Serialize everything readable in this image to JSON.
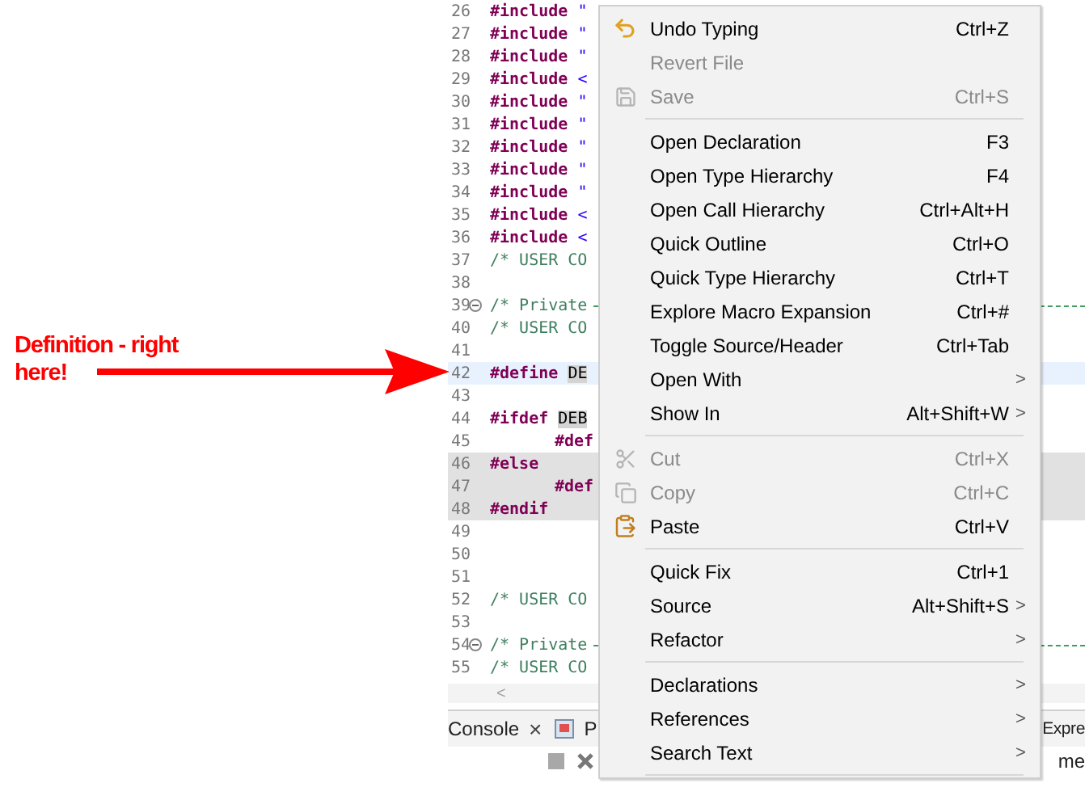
{
  "annotation": {
    "text": "Definition - right here!"
  },
  "editor": {
    "lines": [
      {
        "number": "26",
        "directive": "#include",
        "arg": "\"",
        "current": false,
        "inactive": false
      },
      {
        "number": "27",
        "directive": "#include",
        "arg": "\"",
        "current": false,
        "inactive": false
      },
      {
        "number": "28",
        "directive": "#include",
        "arg": "\"",
        "current": false,
        "inactive": false
      },
      {
        "number": "29",
        "directive": "#include",
        "arg": "<",
        "current": false,
        "inactive": false
      },
      {
        "number": "30",
        "directive": "#include",
        "arg": "\"",
        "current": false,
        "inactive": false
      },
      {
        "number": "31",
        "directive": "#include",
        "arg": "\"",
        "current": false,
        "inactive": false
      },
      {
        "number": "32",
        "directive": "#include",
        "arg": "\"",
        "current": false,
        "inactive": false
      },
      {
        "number": "33",
        "directive": "#include",
        "arg": "\"",
        "current": false,
        "inactive": false
      },
      {
        "number": "34",
        "directive": "#include",
        "arg": "\"",
        "current": false,
        "inactive": false
      },
      {
        "number": "35",
        "directive": "#include",
        "arg": "<",
        "current": false,
        "inactive": false
      },
      {
        "number": "36",
        "directive": "#include",
        "arg": "<",
        "current": false,
        "inactive": false
      },
      {
        "number": "37",
        "comment": "/* USER CO",
        "current": false,
        "inactive": false
      },
      {
        "number": "38",
        "current": false,
        "inactive": false
      },
      {
        "number": "39",
        "collapsible": true,
        "comment": "/* Private",
        "current": false,
        "inactive": false
      },
      {
        "number": "40",
        "comment": "/* USER CO",
        "current": false,
        "inactive": false
      },
      {
        "number": "41",
        "current": false,
        "inactive": false
      },
      {
        "number": "42",
        "directive": "#define",
        "occurrence": "DE",
        "current": true,
        "inactive": false
      },
      {
        "number": "43",
        "current": false,
        "inactive": false
      },
      {
        "number": "44",
        "directive": "#ifdef",
        "occurrence": "DEB",
        "current": false,
        "inactive": false
      },
      {
        "number": "45",
        "indent": true,
        "directive": "#def",
        "current": false,
        "inactive": false
      },
      {
        "number": "46",
        "directive": "#else",
        "current": false,
        "inactive": true
      },
      {
        "number": "47",
        "indent": true,
        "directive": "#def",
        "current": false,
        "inactive": true
      },
      {
        "number": "48",
        "directive": "#endif",
        "current": false,
        "inactive": true
      },
      {
        "number": "49",
        "current": false,
        "inactive": false
      },
      {
        "number": "50",
        "current": false,
        "inactive": false
      },
      {
        "number": "51",
        "current": false,
        "inactive": false
      },
      {
        "number": "52",
        "comment": "/* USER CO",
        "current": false,
        "inactive": false
      },
      {
        "number": "53",
        "current": false,
        "inactive": false
      },
      {
        "number": "54",
        "collapsible": true,
        "comment": "/* Private",
        "current": false,
        "inactive": false
      },
      {
        "number": "55",
        "comment": "/* USER CO",
        "current": false,
        "inactive": false
      }
    ],
    "scroll_arrow": "<"
  },
  "bottom_panel": {
    "tabs": [
      {
        "label": "Console",
        "close": "×"
      },
      {
        "label": "P",
        "icon": true
      }
    ],
    "right_tab": "Expre",
    "right_text": "me"
  },
  "context_menu": [
    {
      "kind": "undo",
      "label": "Undo Typing",
      "shortcut": "Ctrl+Z",
      "disabled": false
    },
    {
      "kind": "item",
      "label": "Revert File",
      "disabled": true
    },
    {
      "kind": "save",
      "label": "Save",
      "shortcut": "Ctrl+S",
      "disabled": true
    },
    {
      "kind": "separator"
    },
    {
      "kind": "item",
      "label": "Open Declaration",
      "shortcut": "F3",
      "disabled": false
    },
    {
      "kind": "item",
      "label": "Open Type Hierarchy",
      "shortcut": "F4",
      "disabled": false
    },
    {
      "kind": "item",
      "label": "Open Call Hierarchy",
      "shortcut": "Ctrl+Alt+H",
      "disabled": false
    },
    {
      "kind": "item",
      "label": "Quick Outline",
      "shortcut": "Ctrl+O",
      "disabled": false
    },
    {
      "kind": "item",
      "label": "Quick Type Hierarchy",
      "shortcut": "Ctrl+T",
      "disabled": false
    },
    {
      "kind": "item",
      "label": "Explore Macro Expansion",
      "shortcut": "Ctrl+#",
      "disabled": false
    },
    {
      "kind": "item",
      "label": "Toggle Source/Header",
      "shortcut": "Ctrl+Tab",
      "disabled": false
    },
    {
      "kind": "item",
      "label": "Open With",
      "submenu": ">",
      "disabled": false
    },
    {
      "kind": "item",
      "label": "Show In",
      "shortcut": "Alt+Shift+W",
      "submenu": ">",
      "disabled": false
    },
    {
      "kind": "separator"
    },
    {
      "kind": "cut",
      "label": "Cut",
      "shortcut": "Ctrl+X",
      "disabled": true
    },
    {
      "kind": "copy",
      "label": "Copy",
      "shortcut": "Ctrl+C",
      "disabled": true
    },
    {
      "kind": "paste",
      "label": "Paste",
      "shortcut": "Ctrl+V",
      "disabled": false
    },
    {
      "kind": "separator"
    },
    {
      "kind": "item",
      "label": "Quick Fix",
      "shortcut": "Ctrl+1",
      "disabled": false
    },
    {
      "kind": "item",
      "label": "Source",
      "shortcut": "Alt+Shift+S",
      "submenu": ">",
      "disabled": false
    },
    {
      "kind": "item",
      "label": "Refactor",
      "submenu": ">",
      "disabled": false
    },
    {
      "kind": "separator"
    },
    {
      "kind": "item",
      "label": "Declarations",
      "submenu": ">",
      "disabled": false
    },
    {
      "kind": "item",
      "label": "References",
      "submenu": ">",
      "disabled": false
    },
    {
      "kind": "item",
      "label": "Search Text",
      "submenu": ">",
      "disabled": false
    },
    {
      "kind": "separator"
    }
  ]
}
